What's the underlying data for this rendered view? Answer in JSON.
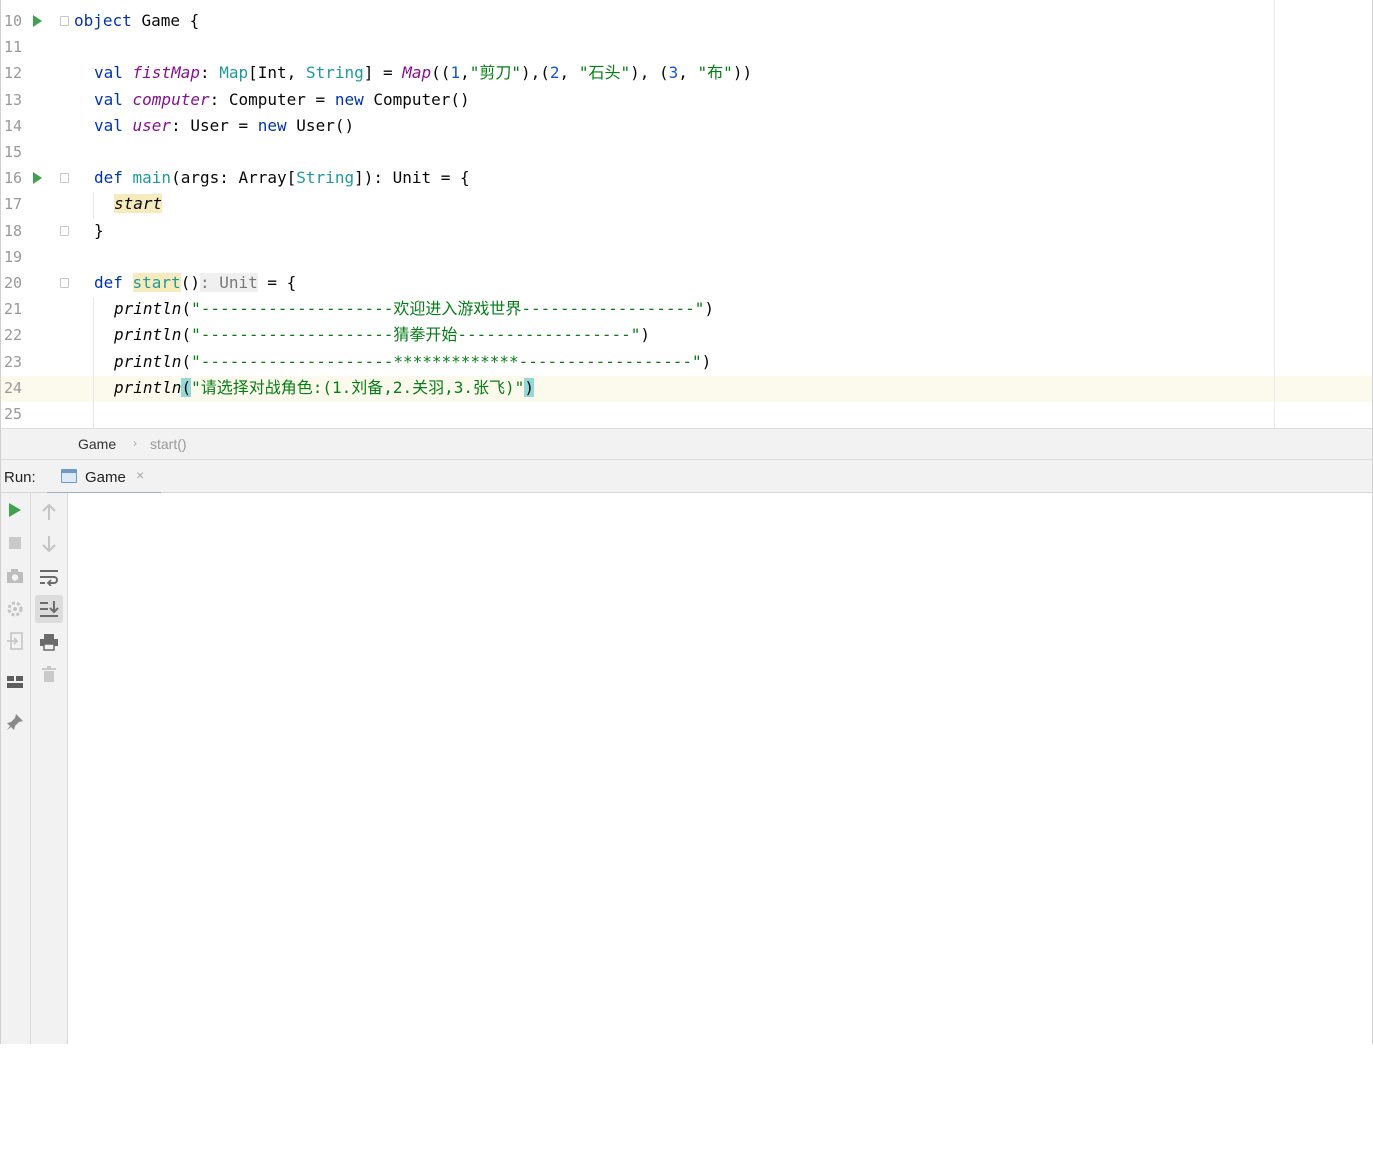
{
  "editor": {
    "lines": [
      {
        "num": "10",
        "tokens": [
          {
            "t": "object ",
            "c": "kw"
          },
          {
            "t": "Game {",
            "c": "pl"
          }
        ]
      },
      {
        "num": "11",
        "tokens": []
      },
      {
        "num": "12",
        "tokens": [
          {
            "t": "val ",
            "c": "kw"
          },
          {
            "t": "fistMap",
            "c": "fld"
          },
          {
            "t": ": ",
            "c": "pl"
          },
          {
            "t": "Map",
            "c": "typ"
          },
          {
            "t": "[Int, ",
            "c": "pl"
          },
          {
            "t": "String",
            "c": "typ"
          },
          {
            "t": "] = ",
            "c": "pl"
          },
          {
            "t": "Map",
            "c": "fld"
          },
          {
            "t": "((",
            "c": "pl"
          },
          {
            "t": "1",
            "c": "num"
          },
          {
            "t": ",",
            "c": "pl"
          },
          {
            "t": "\"剪刀\"",
            "c": "str"
          },
          {
            "t": "),(",
            "c": "pl"
          },
          {
            "t": "2",
            "c": "num"
          },
          {
            "t": ", ",
            "c": "pl"
          },
          {
            "t": "\"石头\"",
            "c": "str"
          },
          {
            "t": "), (",
            "c": "pl"
          },
          {
            "t": "3",
            "c": "num"
          },
          {
            "t": ", ",
            "c": "pl"
          },
          {
            "t": "\"布\"",
            "c": "str"
          },
          {
            "t": "))",
            "c": "pl"
          }
        ]
      },
      {
        "num": "13",
        "tokens": [
          {
            "t": "val ",
            "c": "kw"
          },
          {
            "t": "computer",
            "c": "fld"
          },
          {
            "t": ": Computer = ",
            "c": "pl"
          },
          {
            "t": "new ",
            "c": "kw"
          },
          {
            "t": "Computer()",
            "c": "pl"
          }
        ]
      },
      {
        "num": "14",
        "tokens": [
          {
            "t": "val ",
            "c": "kw"
          },
          {
            "t": "user",
            "c": "fld"
          },
          {
            "t": ": User = ",
            "c": "pl"
          },
          {
            "t": "new ",
            "c": "kw"
          },
          {
            "t": "User()",
            "c": "pl"
          }
        ]
      },
      {
        "num": "15",
        "tokens": []
      },
      {
        "num": "16",
        "tokens": [
          {
            "t": "def ",
            "c": "kw"
          },
          {
            "t": "main",
            "c": "typ"
          },
          {
            "t": "(args: Array[",
            "c": "pl"
          },
          {
            "t": "String",
            "c": "typ"
          },
          {
            "t": "]): Unit = {",
            "c": "pl"
          }
        ]
      },
      {
        "num": "17",
        "tokens": [
          {
            "t": "start",
            "c": "ital usage"
          }
        ]
      },
      {
        "num": "18",
        "tokens": [
          {
            "t": "}",
            "c": "pl"
          }
        ]
      },
      {
        "num": "19",
        "tokens": []
      },
      {
        "num": "20",
        "tokens": [
          {
            "t": "def ",
            "c": "kw"
          },
          {
            "t": "start",
            "c": "typ usage"
          },
          {
            "t": "()",
            "c": "pl"
          },
          {
            "t": ": Unit",
            "c": "hint"
          },
          {
            "t": " = {",
            "c": "pl"
          }
        ]
      },
      {
        "num": "21",
        "tokens": [
          {
            "t": "println",
            "c": "ital"
          },
          {
            "t": "(",
            "c": "pl"
          },
          {
            "t": "\"--------------------欢迎进入游戏世界------------------\"",
            "c": "str"
          },
          {
            "t": ")",
            "c": "pl"
          }
        ]
      },
      {
        "num": "22",
        "tokens": [
          {
            "t": "println",
            "c": "ital"
          },
          {
            "t": "(",
            "c": "pl"
          },
          {
            "t": "\"--------------------猜拳开始------------------\"",
            "c": "str"
          },
          {
            "t": ")",
            "c": "pl"
          }
        ]
      },
      {
        "num": "23",
        "tokens": [
          {
            "t": "println",
            "c": "ital"
          },
          {
            "t": "(",
            "c": "pl"
          },
          {
            "t": "\"--------------------*************------------------\"",
            "c": "str"
          },
          {
            "t": ")",
            "c": "pl"
          }
        ]
      },
      {
        "num": "24",
        "tokens": [
          {
            "t": "println",
            "c": "ital"
          },
          {
            "t": "(",
            "c": "pl paren-hl"
          },
          {
            "t": "\"请选择对战角色:(1.刘备,2.关羽,3.张飞)\"",
            "c": "str"
          },
          {
            "t": ")",
            "c": "pl paren-hl"
          }
        ]
      },
      {
        "num": "25",
        "tokens": []
      }
    ]
  },
  "breadcrumb": {
    "item1": "Game",
    "separator": "›",
    "item2": "start()"
  },
  "run_panel": {
    "title": "Run:",
    "tab_label": "Game",
    "tab_close": "×"
  },
  "colors": {
    "keyword": "#0033b3",
    "field": "#871094",
    "type": "#20999d",
    "string": "#067d17",
    "number": "#1750eb",
    "run_green": "#40a14f"
  },
  "icons": {
    "left_toolbar": [
      "rerun-icon",
      "stop-icon",
      "camera-icon",
      "settings-icon",
      "restore-layout-icon",
      "layout-icon",
      "pin-icon"
    ],
    "right_toolbar": [
      "up-arrow-icon",
      "down-arrow-icon",
      "soft-wrap-icon",
      "scroll-to-end-icon",
      "print-icon",
      "trash-icon"
    ]
  }
}
